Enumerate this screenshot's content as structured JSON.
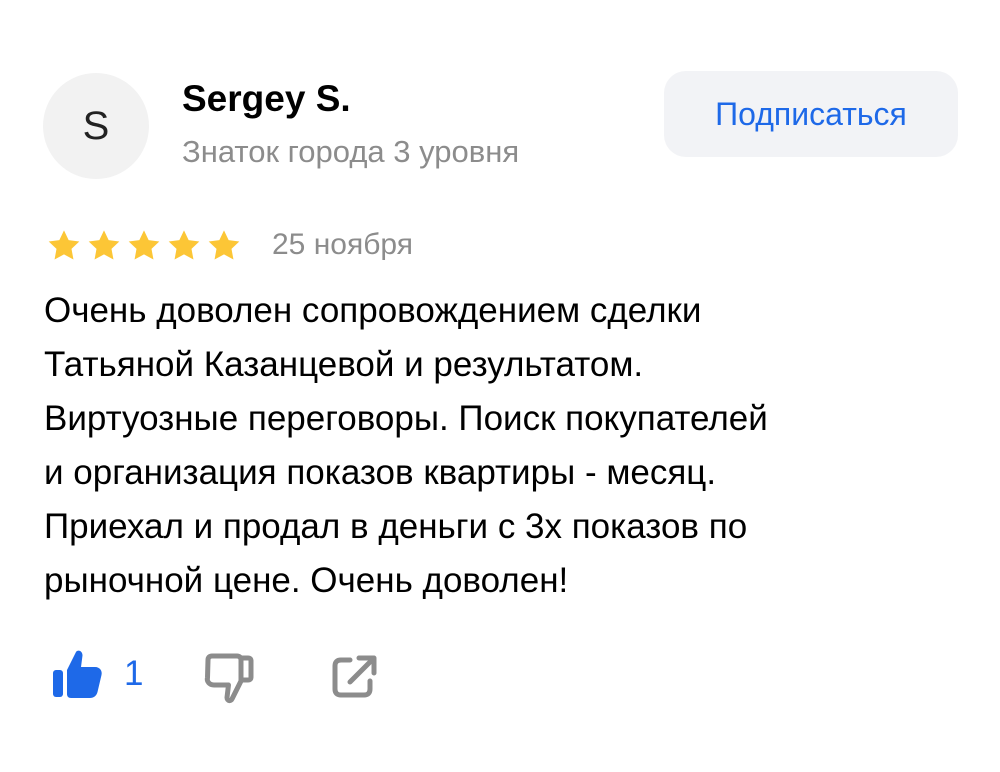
{
  "author": {
    "avatar_initial": "S",
    "name": "Sergey S.",
    "level": "Знаток города 3 уровня"
  },
  "subscribe": {
    "label": "Подписаться"
  },
  "review": {
    "rating": 5,
    "rating_max": 5,
    "date": "25 ноября",
    "text_lines": [
      "Очень доволен сопровождением сделки",
      "Татьяной Казанцевой и результатом.",
      "Виртуозные переговоры. Поиск покупателей",
      "и организация показов квартиры - месяц.",
      "Приехал и продал в деньги с 3х показов по",
      "рыночной цене. Очень доволен!"
    ]
  },
  "actions": {
    "like_count": "1",
    "like_icon": "thumbs-up-icon",
    "dislike_icon": "thumbs-down-icon",
    "share_icon": "share-icon"
  },
  "colors": {
    "accent": "#1e69e8",
    "star": "#fcc636",
    "muted_text": "#8c8c8c",
    "button_bg": "#f2f3f6",
    "avatar_bg": "#f2f2f2"
  }
}
